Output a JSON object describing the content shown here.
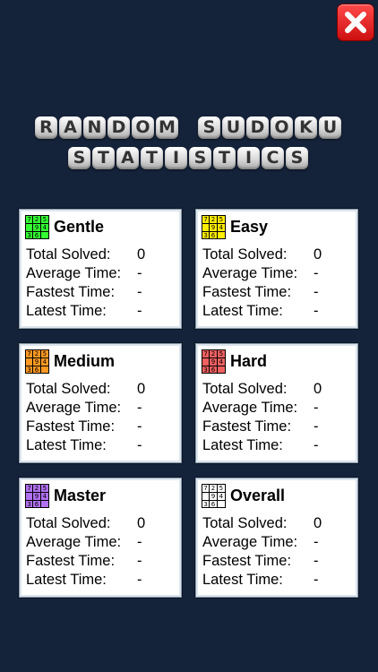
{
  "close_icon": "close-x-icon",
  "title": {
    "line1": [
      "R",
      "A",
      "N",
      "D",
      "O",
      "M",
      " ",
      "S",
      "U",
      "D",
      "O",
      "K",
      "U"
    ],
    "line2": [
      "S",
      "T",
      "A",
      "T",
      "I",
      "S",
      "T",
      "I",
      "C",
      "S"
    ]
  },
  "grid_digits": [
    "7",
    "2",
    "5",
    "",
    "9",
    "4",
    "3",
    "6",
    ""
  ],
  "labels": {
    "total_solved": "Total Solved:",
    "average_time": "Average Time:",
    "fastest_time": "Fastest Time:",
    "latest_time": "Latest Time:"
  },
  "cards": [
    {
      "id": "gentle",
      "title": "Gentle",
      "color": "#33ff33",
      "total_solved": "0",
      "average_time": "-",
      "fastest_time": "-",
      "latest_time": "-"
    },
    {
      "id": "easy",
      "title": "Easy",
      "color": "#ffee00",
      "total_solved": "0",
      "average_time": "-",
      "fastest_time": "-",
      "latest_time": "-"
    },
    {
      "id": "medium",
      "title": "Medium",
      "color": "#ff9922",
      "total_solved": "0",
      "average_time": "-",
      "fastest_time": "-",
      "latest_time": "-"
    },
    {
      "id": "hard",
      "title": "Hard",
      "color": "#f06060",
      "total_solved": "0",
      "average_time": "-",
      "fastest_time": "-",
      "latest_time": "-"
    },
    {
      "id": "master",
      "title": "Master",
      "color": "#b070f0",
      "total_solved": "0",
      "average_time": "-",
      "fastest_time": "-",
      "latest_time": "-"
    },
    {
      "id": "overall",
      "title": "Overall",
      "color": "#ffffff",
      "total_solved": "0",
      "average_time": "-",
      "fastest_time": "-",
      "latest_time": "-"
    }
  ]
}
